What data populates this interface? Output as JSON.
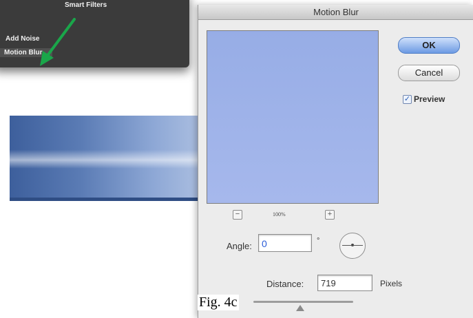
{
  "menu": {
    "items": [
      "Smart Filters",
      "Add Noise",
      "Motion Blur"
    ]
  },
  "dialog": {
    "title": "Motion Blur",
    "ok_label": "OK",
    "cancel_label": "Cancel",
    "preview_label": "Preview",
    "preview_checked": true,
    "zoom_level": "100%",
    "zoom_minus": "−",
    "zoom_plus": "+",
    "angle_label": "Angle:",
    "angle_value": "0",
    "degree_symbol": "°",
    "distance_label": "Distance:",
    "distance_value": "719",
    "distance_unit": "Pixels"
  },
  "caption": "Fig. 4c",
  "colors": {
    "arrow": "#1aa64a",
    "preview_fill": "#a1b4ea",
    "menu_bg": "#3b3b3b"
  }
}
